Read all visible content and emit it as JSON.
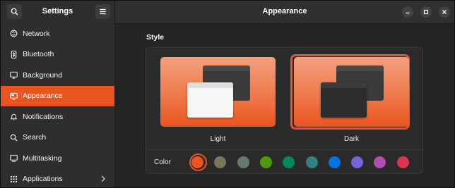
{
  "sidebar": {
    "title": "Settings",
    "search_icon": "search-icon",
    "menu_icon": "hamburger-menu-icon",
    "items": [
      {
        "label": "Network",
        "icon": "network-icon"
      },
      {
        "label": "Bluetooth",
        "icon": "bluetooth-icon"
      },
      {
        "label": "Background",
        "icon": "display-icon"
      },
      {
        "label": "Appearance",
        "icon": "appearance-icon",
        "active": true
      },
      {
        "label": "Notifications",
        "icon": "bell-icon"
      },
      {
        "label": "Search",
        "icon": "search-icon"
      },
      {
        "label": "Multitasking",
        "icon": "multitasking-icon"
      },
      {
        "label": "Applications",
        "icon": "grid-icon",
        "has_submenu": true
      }
    ]
  },
  "header": {
    "title": "Appearance",
    "controls": [
      "minimize-icon",
      "maximize-icon",
      "close-icon"
    ]
  },
  "style": {
    "section_title": "Style",
    "options": [
      {
        "label": "Light",
        "selected": false
      },
      {
        "label": "Dark",
        "selected": true
      }
    ]
  },
  "color": {
    "label": "Color",
    "swatches": [
      "#e95420",
      "#787859",
      "#657b69",
      "#4e9a06",
      "#03875b",
      "#308280",
      "#0073e5",
      "#7764d8",
      "#b34cb3",
      "#da3450"
    ],
    "selected_index": 0
  },
  "colors": {
    "accent": "#e95420",
    "sidebar_bg": "#2e2e2e",
    "content_bg": "#242424"
  }
}
